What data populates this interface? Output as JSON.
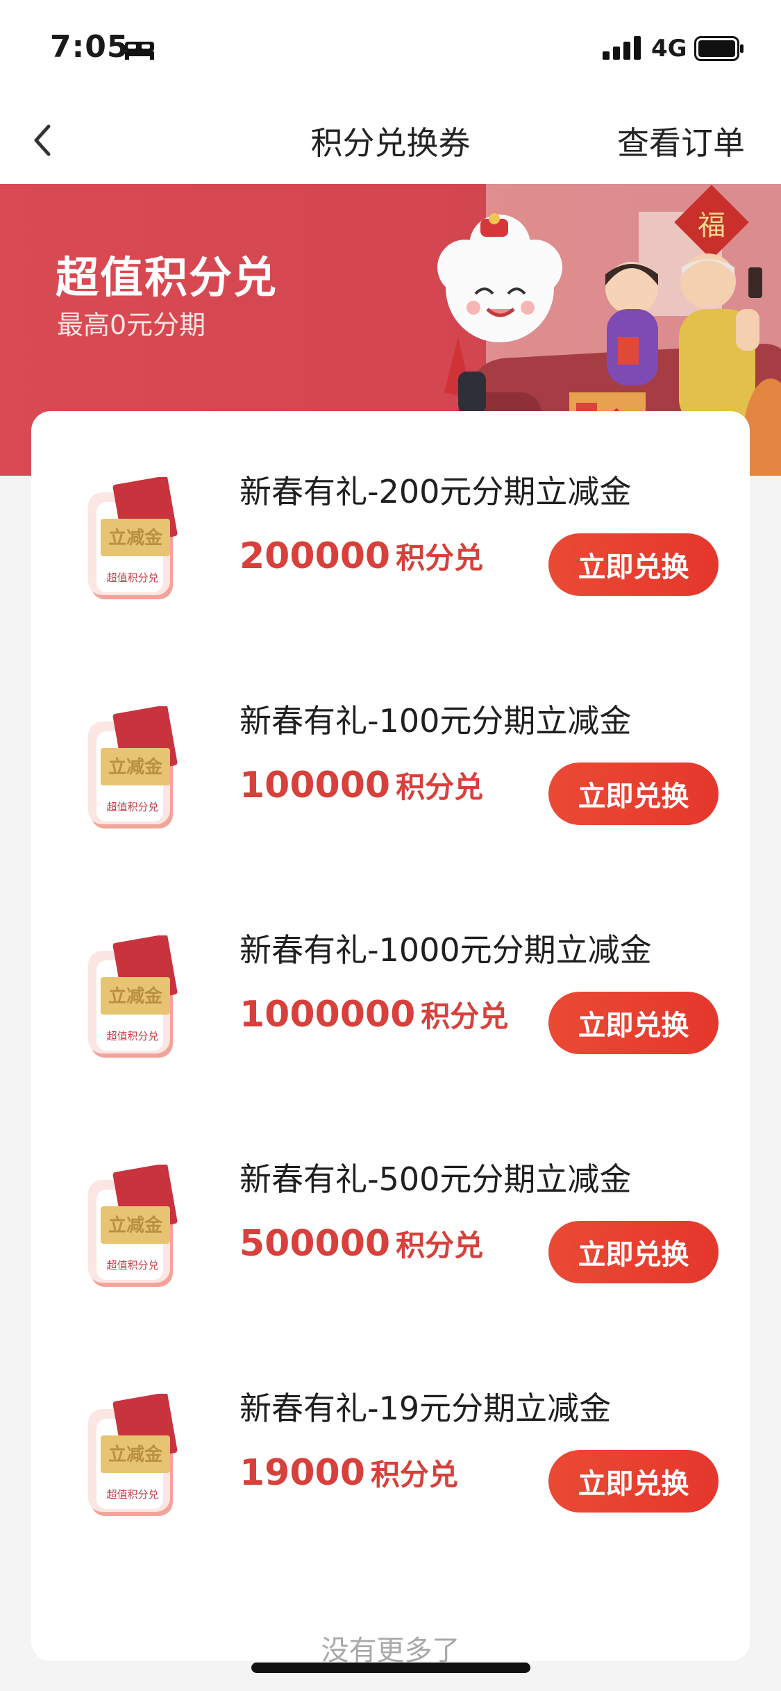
{
  "status_bar": {
    "time": "7:05",
    "network": "4G",
    "icons": [
      "bed-icon",
      "signal-icon",
      "battery-icon"
    ]
  },
  "nav": {
    "title": "积分兑换券",
    "right_link": "查看订单",
    "back_icon": "chevron-left-icon"
  },
  "banner": {
    "title": "超值积分兑",
    "subtitle": "最高0元分期",
    "illustration_text": "福",
    "color": "#d94a52"
  },
  "thumb": {
    "label_top": "立减金",
    "label_bottom": "超值积分兑"
  },
  "items": [
    {
      "title": "新春有礼-200元分期立减金",
      "points": "200000",
      "points_suffix": "积分兑",
      "button": "立即兑换"
    },
    {
      "title": "新春有礼-100元分期立减金",
      "points": "100000",
      "points_suffix": "积分兑",
      "button": "立即兑换"
    },
    {
      "title": "新春有礼-1000元分期立减金",
      "points": "1000000",
      "points_suffix": "积分兑",
      "button": "立即兑换"
    },
    {
      "title": "新春有礼-500元分期立减金",
      "points": "500000",
      "points_suffix": "积分兑",
      "button": "立即兑换"
    },
    {
      "title": "新春有礼-19元分期立减金",
      "points": "19000",
      "points_suffix": "积分兑",
      "button": "立即兑换"
    }
  ],
  "footer": {
    "no_more": "没有更多了"
  },
  "colors": {
    "accent": "#e5372c",
    "points": "#d7403b"
  }
}
